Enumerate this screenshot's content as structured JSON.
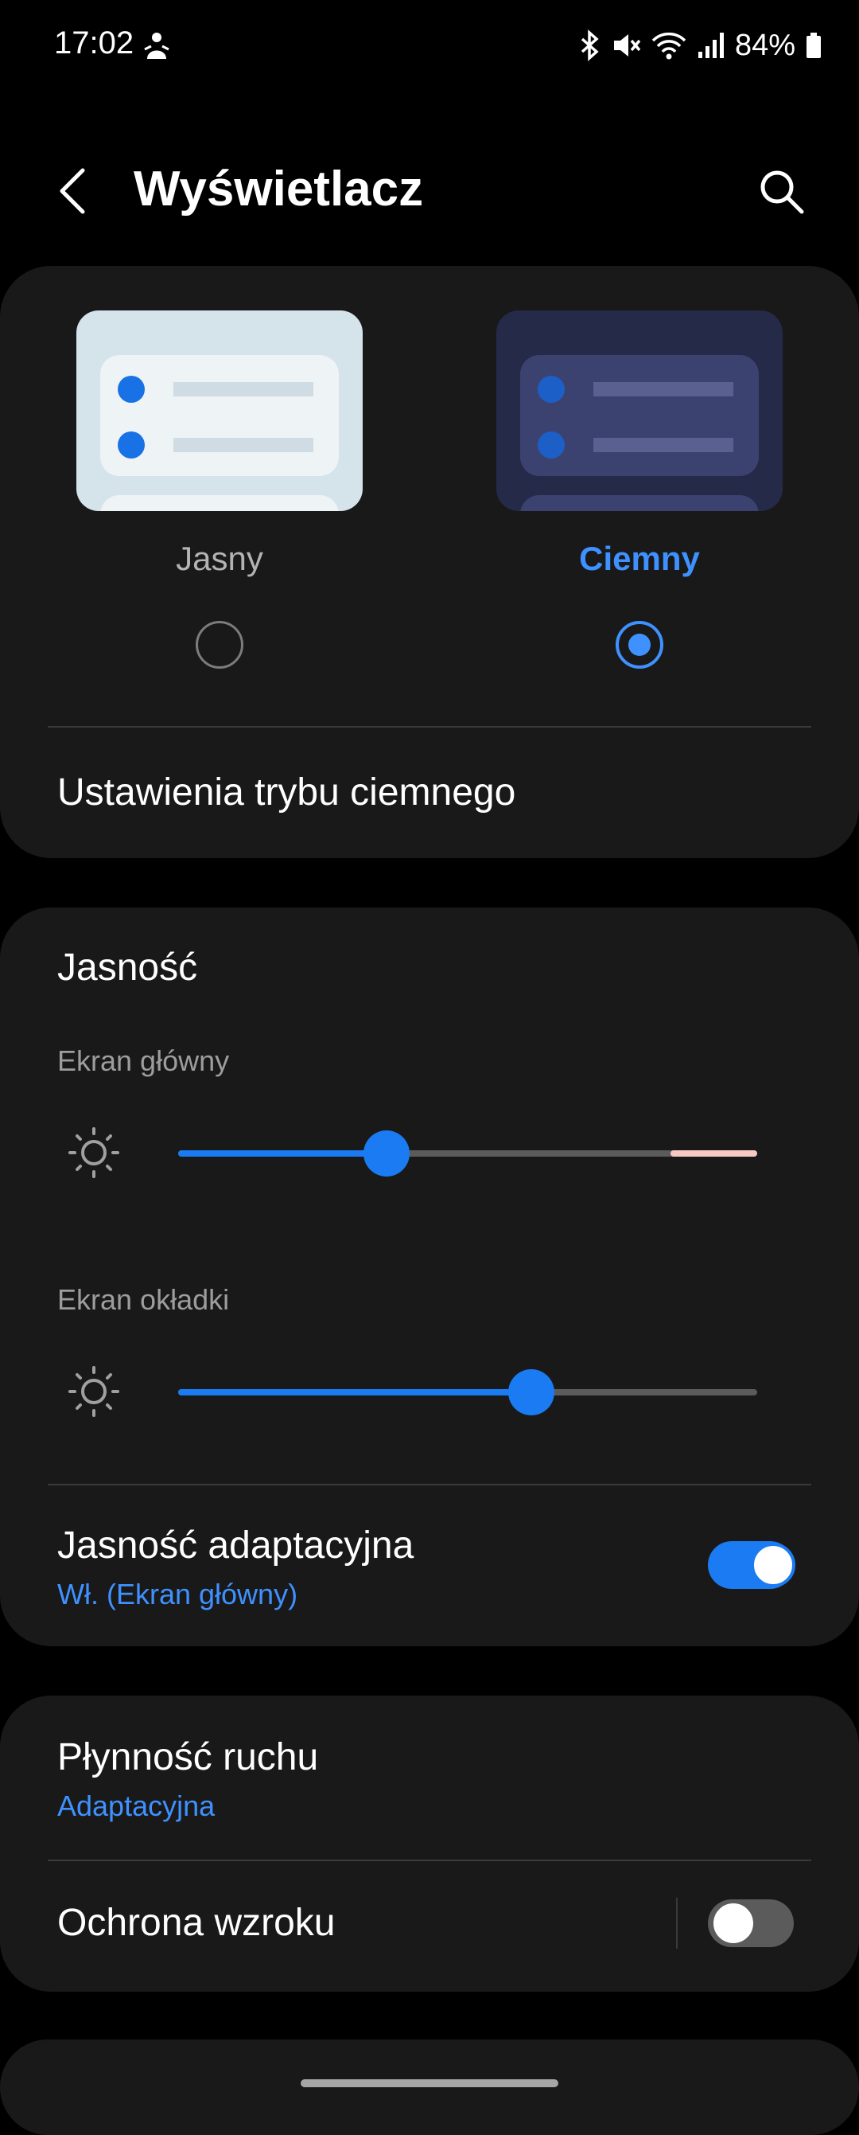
{
  "status_bar": {
    "time": "17:02",
    "battery": "84%",
    "icons": [
      "person-notification-icon",
      "bluetooth-icon",
      "mute-icon",
      "wifi-icon",
      "signal-icon",
      "battery-icon"
    ]
  },
  "header": {
    "title": "Wyświetlacz",
    "back_icon": "back-arrow-icon",
    "search_icon": "search-icon"
  },
  "theme": {
    "options": [
      {
        "label": "Jasny",
        "selected": false
      },
      {
        "label": "Ciemny",
        "selected": true
      }
    ],
    "dark_mode_settings": "Ustawienia trybu ciemnego",
    "selected_color": "#3e91ff"
  },
  "brightness": {
    "title": "Jasność",
    "main_screen": {
      "label": "Ekran główny",
      "level": 0.36,
      "hdr_start": 0.85
    },
    "cover_screen": {
      "label": "Ekran okładki",
      "level": 0.61
    },
    "adaptive": {
      "title": "Jasność adaptacyjna",
      "subtitle": "Wł. (Ekran główny)",
      "on": true
    }
  },
  "motion": {
    "smoothness": {
      "title": "Płynność ruchu",
      "subtitle": "Adaptacyjna"
    },
    "eye_comfort": {
      "title": "Ochrona wzroku",
      "on": false
    }
  },
  "colors": {
    "accent": "#1a7bf2",
    "card": "#191919",
    "background": "#000000"
  }
}
